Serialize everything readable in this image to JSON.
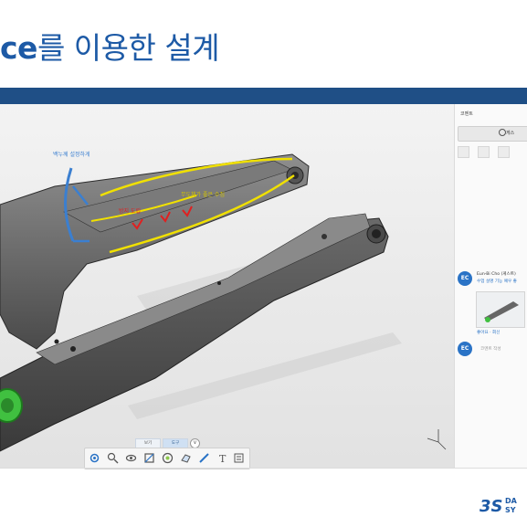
{
  "slide": {
    "title_bold": "ce",
    "title_rest": "를 이용한 설계"
  },
  "annotations": {
    "blue_note": "백누께 설정하게",
    "yellow_note": "무도체가 좋은 수집",
    "red_note": "방지 도립"
  },
  "panel": {
    "title": "코멘트",
    "share_label": "게스",
    "comment_author": "Eun-Bi Cho (게스트)",
    "comment_text": "수업 설명 기능 예우 좋",
    "comment_actions": "좋아요 · 회신",
    "reply_placeholder": "코멘트 작성",
    "avatar_initials": "EC"
  },
  "toolbar": {
    "tab_view": "보기",
    "tab_tools": "도구",
    "chevron": "∨"
  },
  "colors": {
    "title_blue": "#1d5aa6",
    "header_bar": "#1f4f86",
    "avatar_blue": "#2a73c6",
    "highlight_yellow": "#f0e000",
    "note_blue": "#3b7fd0",
    "mark_red": "#e02020"
  }
}
